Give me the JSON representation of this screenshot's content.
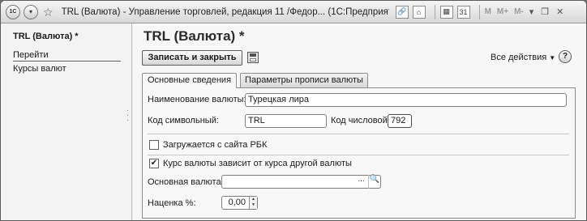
{
  "window": {
    "title": "TRL (Валюта) - Управление торговлей, редакция 11 /Федор...   (1С:Предприятие)",
    "app_badge": "1С",
    "memory_buttons": [
      "M",
      "M+",
      "M-"
    ]
  },
  "left_panel": {
    "title": "TRL (Валюта) *",
    "nav_header": "Перейти",
    "nav_items": [
      "Курсы валют"
    ]
  },
  "form": {
    "title": "TRL (Валюта) *",
    "save_close_label": "Записать и закрыть",
    "all_actions_label": "Все действия",
    "help_label": "?",
    "tabs": [
      "Основные сведения",
      "Параметры прописи валюты"
    ],
    "fields": {
      "name_label": "Наименование валюты:",
      "name_value": "Турецкая лира",
      "code_symbolic_label": "Код символьный:",
      "code_symbolic_value": "TRL",
      "code_numeric_label": "Код числовой:",
      "code_numeric_value": "792",
      "rbc_checkbox_label": "Загружается с сайта РБК",
      "rbc_checked": false,
      "depends_checkbox_label": "Курс валюты зависит от курса другой валюты",
      "depends_checked": true,
      "base_currency_label": "Основная валюта:",
      "base_currency_value": "",
      "markup_label": "Наценка %:",
      "markup_value": "0,00"
    }
  }
}
